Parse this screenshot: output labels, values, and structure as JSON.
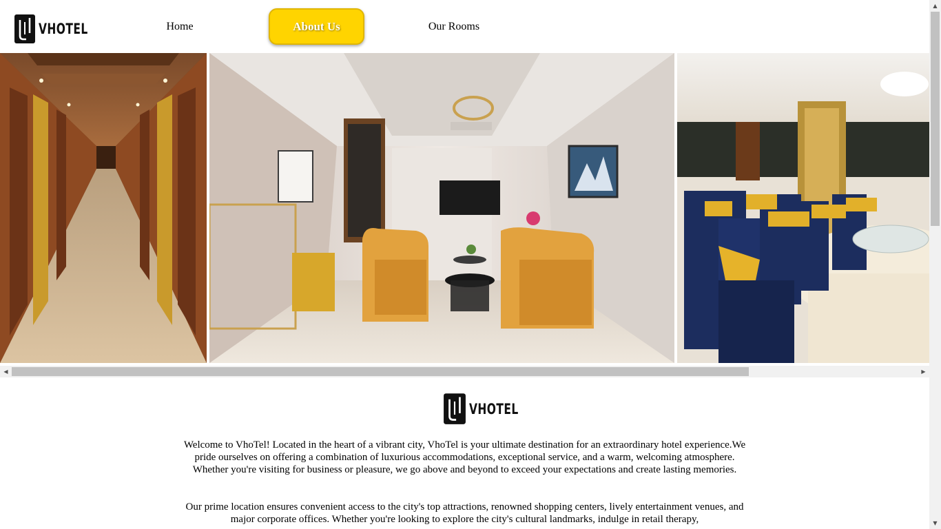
{
  "brand": {
    "name": "VHOTEL"
  },
  "nav": {
    "items": [
      {
        "label": "Home"
      },
      {
        "label": "About Us"
      },
      {
        "label": "Our Rooms"
      }
    ],
    "active_index": 1
  },
  "gallery": {
    "images": [
      {
        "subject": "hotel corridor"
      },
      {
        "subject": "lobby lounge"
      },
      {
        "subject": "banquet hall"
      }
    ]
  },
  "about": {
    "paragraphs": [
      "Welcome to VhoTel! Located in the heart of a vibrant city, VhoTel is your ultimate destination for an extraordinary hotel experience.We pride ourselves on offering a combination of luxurious accommodations, exceptional service, and a warm, welcoming atmosphere. Whether you're visiting for business or pleasure, we go above and beyond to exceed your expectations and create lasting memories.",
      "Our prime location ensures convenient access to the city's top attractions, renowned shopping centers, lively entertainment venues, and major corporate offices. Whether you're looking to explore the city's cultural landmarks, indulge in retail therapy,"
    ]
  },
  "colors": {
    "accent": "#ffd400",
    "accent_text": "#ffffff",
    "text": "#000000",
    "background": "#ffffff"
  }
}
